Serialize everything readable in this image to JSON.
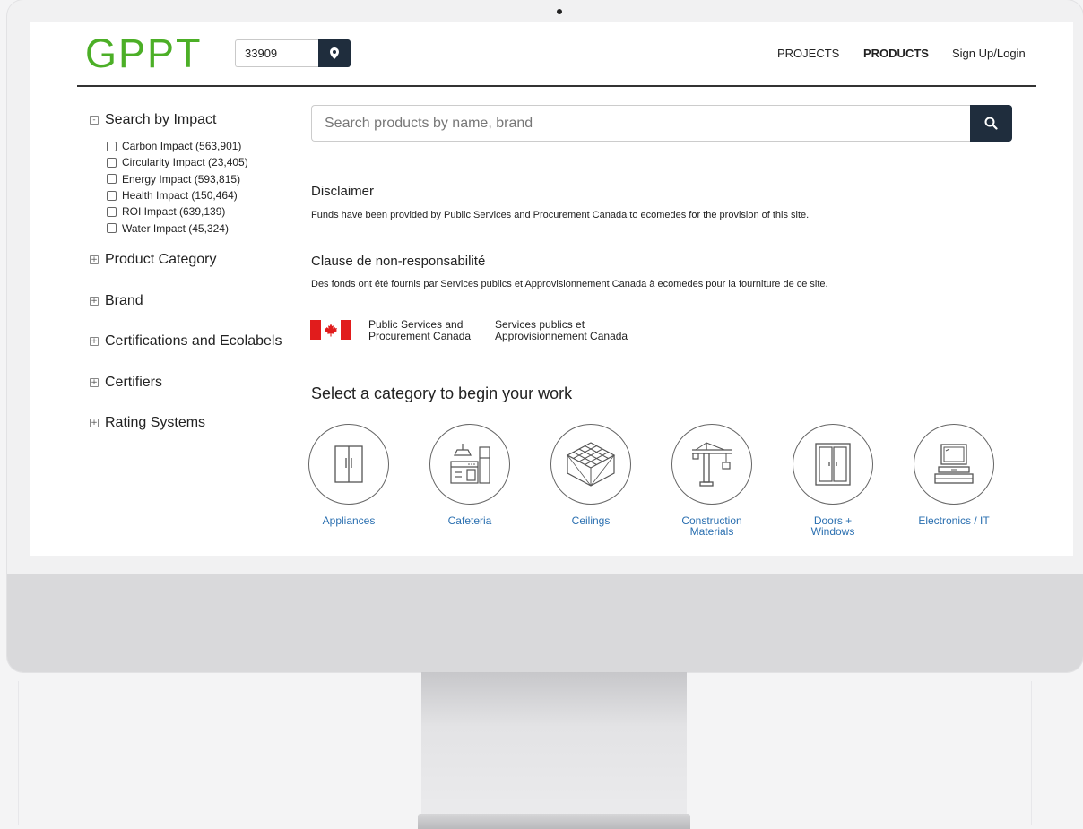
{
  "header": {
    "logo": "GPPT",
    "zip_value": "33909",
    "location_icon": "map-marker-icon",
    "nav": [
      "PROJECTS",
      "PRODUCTS",
      "Sign Up/Login"
    ],
    "active_nav": "PRODUCTS"
  },
  "sidebar": {
    "search_by_impact": {
      "label": "Search by Impact",
      "toggle": "-",
      "items": [
        "Carbon Impact (563,901)",
        "Circularity Impact (23,405)",
        "Energy Impact (593,815)",
        "Health Impact (150,464)",
        "ROI Impact (639,139)",
        "Water Impact (45,324)"
      ]
    },
    "sections": [
      {
        "label": "Product Category",
        "toggle": "+"
      },
      {
        "label": "Brand",
        "toggle": "+"
      },
      {
        "label": "Certifications and Ecolabels",
        "toggle": "+"
      },
      {
        "label": "Certifiers",
        "toggle": "+"
      },
      {
        "label": "Rating Systems",
        "toggle": "+"
      }
    ]
  },
  "main": {
    "search_placeholder": "Search products by name, brand",
    "search_icon": "search-icon",
    "disclaimer_title": "Disclaimer",
    "disclaimer_text": "Funds have been provided by Public Services and Procurement Canada to ecomedes for the provision of this site.",
    "clause_title": "Clause de non-responsabilité",
    "clause_text": "Des fonds ont été fournis par Services publics et Approvisionnement Canada à ecomedes pour la fourniture de ce site.",
    "gov_en": [
      "Public Services and",
      "Procurement Canada"
    ],
    "gov_fr": [
      "Services publics et",
      "Approvisionnement Canada"
    ],
    "select_heading": "Select a category to begin your work",
    "categories": [
      {
        "label": "Appliances",
        "icon": "refrigerator-icon"
      },
      {
        "label": "Cafeteria",
        "icon": "kitchen-icon"
      },
      {
        "label": "Ceilings",
        "icon": "ceiling-grid-icon"
      },
      {
        "label": "Construction\nMaterials",
        "icon": "crane-icon"
      },
      {
        "label": "Doors +\nWindows",
        "icon": "door-icon"
      },
      {
        "label": "Electronics / IT",
        "icon": "computer-icon"
      }
    ]
  },
  "colors": {
    "logo": "#4caf27",
    "button": "#1f2d3d",
    "link": "#2a6fb0",
    "flag_red": "#e11c1c"
  }
}
